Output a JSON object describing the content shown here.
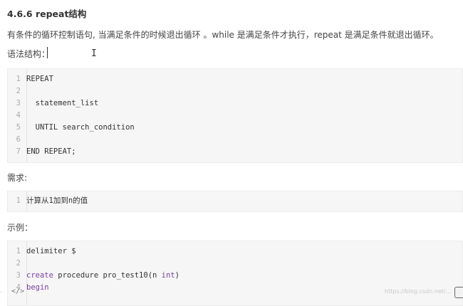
{
  "heading": "4.6.6 repeat结构",
  "intro": "有条件的循环控制语句, 当满足条件的时候退出循环 。while 是满足条件才执行，repeat 是满足条件就退出循环。",
  "syntax_label": "语法结构：",
  "syntax_code": [
    {
      "n": "1",
      "t": "REPEAT"
    },
    {
      "n": "2",
      "t": ""
    },
    {
      "n": "3",
      "t": "  statement_list"
    },
    {
      "n": "4",
      "t": ""
    },
    {
      "n": "5",
      "t": "  UNTIL search_condition"
    },
    {
      "n": "6",
      "t": ""
    },
    {
      "n": "7",
      "t": "END REPEAT;"
    }
  ],
  "req_label": "需求:",
  "req_code": [
    {
      "n": "1",
      "t": "计算从1加到n的值"
    }
  ],
  "example_label": "示例：",
  "example_code": [
    {
      "n": "1",
      "t": "delimiter $"
    },
    {
      "n": "2",
      "t": ""
    },
    {
      "n": "3",
      "kw": "create",
      "rest": " procedure pro_test10(n ",
      "kw2": "int",
      "rest2": ")"
    },
    {
      "n": "4",
      "kw": "begin",
      "rest": "",
      "kw2": "",
      "rest2": ""
    }
  ],
  "footer": {
    "code_icon": "</>",
    "side_dot": "·",
    "watermark": "https://blog.csdn.net/..."
  },
  "colors": {
    "keyword": "#7a3e9d",
    "code_bg": "#f6f6f6"
  }
}
